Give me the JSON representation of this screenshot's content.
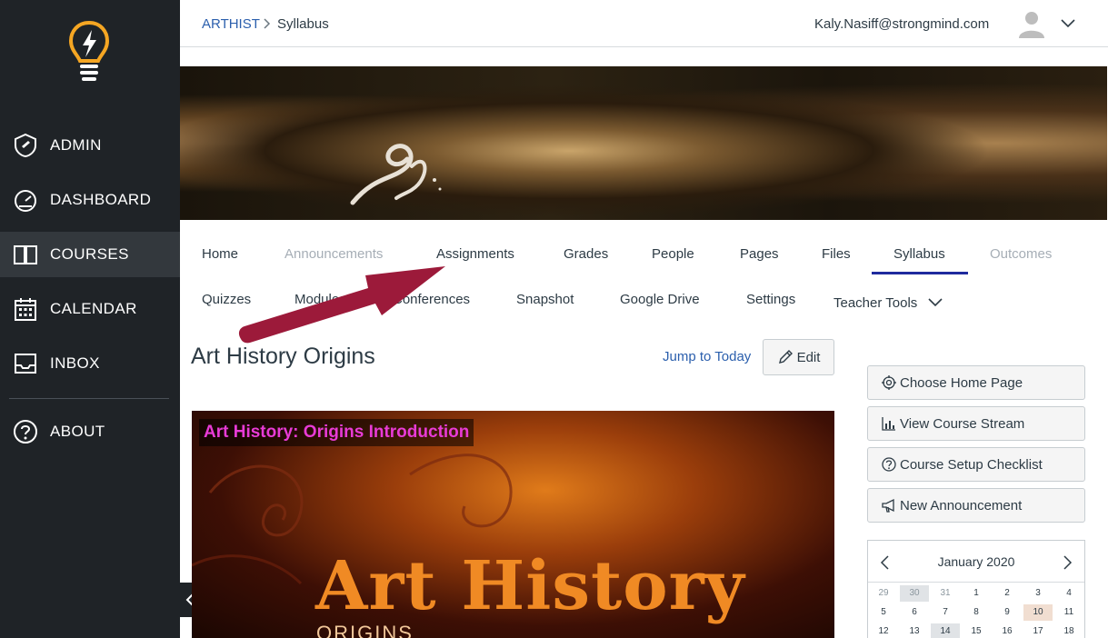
{
  "sidebar": {
    "items": [
      {
        "label": "ADMIN",
        "icon": "admin-shield-icon"
      },
      {
        "label": "DASHBOARD",
        "icon": "dashboard-gauge-icon"
      },
      {
        "label": "COURSES",
        "icon": "book-icon"
      },
      {
        "label": "CALENDAR",
        "icon": "calendar-icon"
      },
      {
        "label": "INBOX",
        "icon": "inbox-icon"
      },
      {
        "label": "ABOUT",
        "icon": "question-icon"
      }
    ],
    "active": "COURSES"
  },
  "header": {
    "breadcrumb_course": "ARTHIST",
    "breadcrumb_page": "Syllabus",
    "user_email": "Kaly.Nasiff@strongmind.com"
  },
  "tabs": {
    "row1": [
      "Home",
      "Announcements",
      "Assignments",
      "Grades",
      "People",
      "Pages",
      "Files",
      "Syllabus",
      "Outcomes"
    ],
    "row2": [
      "Quizzes",
      "Modules",
      "Conferences",
      "Snapshot",
      "Google Drive",
      "Settings",
      "Teacher Tools"
    ],
    "disabled": [
      "Announcements",
      "Outcomes"
    ],
    "active": "Syllabus"
  },
  "content": {
    "title": "Art History Origins",
    "jump_label": "Jump to Today",
    "edit_label": "Edit",
    "hero_caption": "Art History: Origins Introduction",
    "hero_title": "Art History",
    "hero_subtitle": "ORIGINS"
  },
  "side_buttons": [
    {
      "label": "Choose Home Page",
      "icon": "target-icon"
    },
    {
      "label": "View Course Stream",
      "icon": "stream-chart-icon"
    },
    {
      "label": "Course Setup Checklist",
      "icon": "question-circle-icon"
    },
    {
      "label": "New Announcement",
      "icon": "megaphone-icon"
    }
  ],
  "calendar": {
    "month": "January 2020",
    "rows": [
      [
        "29",
        "30",
        "31",
        "1",
        "2",
        "3",
        "4"
      ],
      [
        "5",
        "6",
        "7",
        "8",
        "9",
        "10",
        "11"
      ],
      [
        "12",
        "13",
        "14",
        "15",
        "16",
        "17",
        "18"
      ]
    ],
    "highlight_today": "10",
    "shaded": [
      "30",
      "14"
    ]
  },
  "colors": {
    "sidebar_bg": "#1f2327",
    "link": "#2b5fad",
    "active_tab_underline": "#1f2b9e",
    "hero_caption": "#e83bd6",
    "annotation_arrow": "#9c1a3a"
  }
}
